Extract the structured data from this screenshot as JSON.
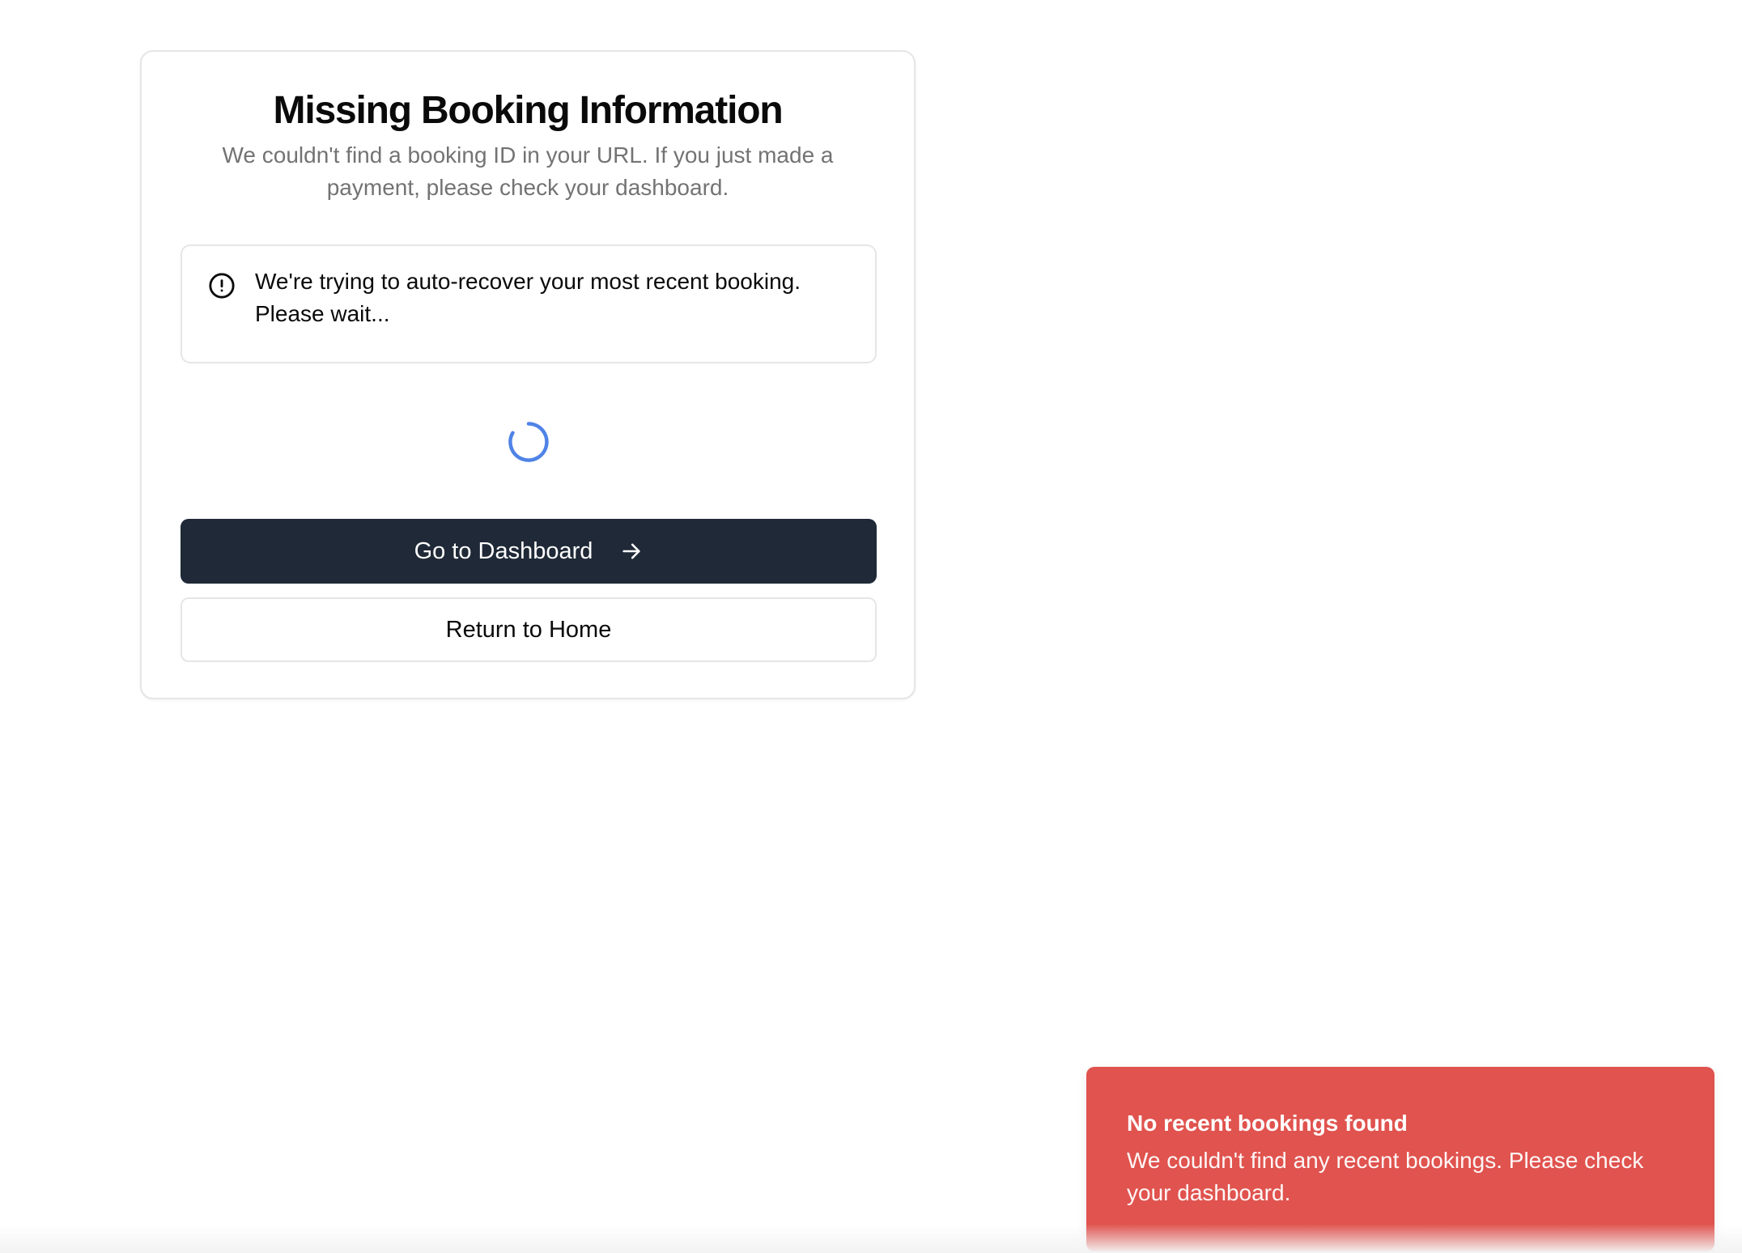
{
  "card": {
    "title": "Missing Booking Information",
    "subtitle": "We couldn't find a booking ID in your URL. If you just made a payment, please check your dashboard."
  },
  "alert": {
    "icon": "alert-circle-icon",
    "message": "We're trying to auto-recover your most recent booking. Please wait..."
  },
  "spinner": {
    "icon": "loading-spinner-icon",
    "color": "#4f83e6"
  },
  "actions": {
    "dashboard_label": "Go to Dashboard",
    "dashboard_icon": "arrow-right-icon",
    "home_label": "Return to Home"
  },
  "toast": {
    "title": "No recent bookings found",
    "description": "We couldn't find any recent bookings. Please check your dashboard.",
    "color": "#e0534e"
  },
  "colors": {
    "primary_button": "#1f2937",
    "border": "#e6e6e6",
    "muted_text": "#737373"
  }
}
